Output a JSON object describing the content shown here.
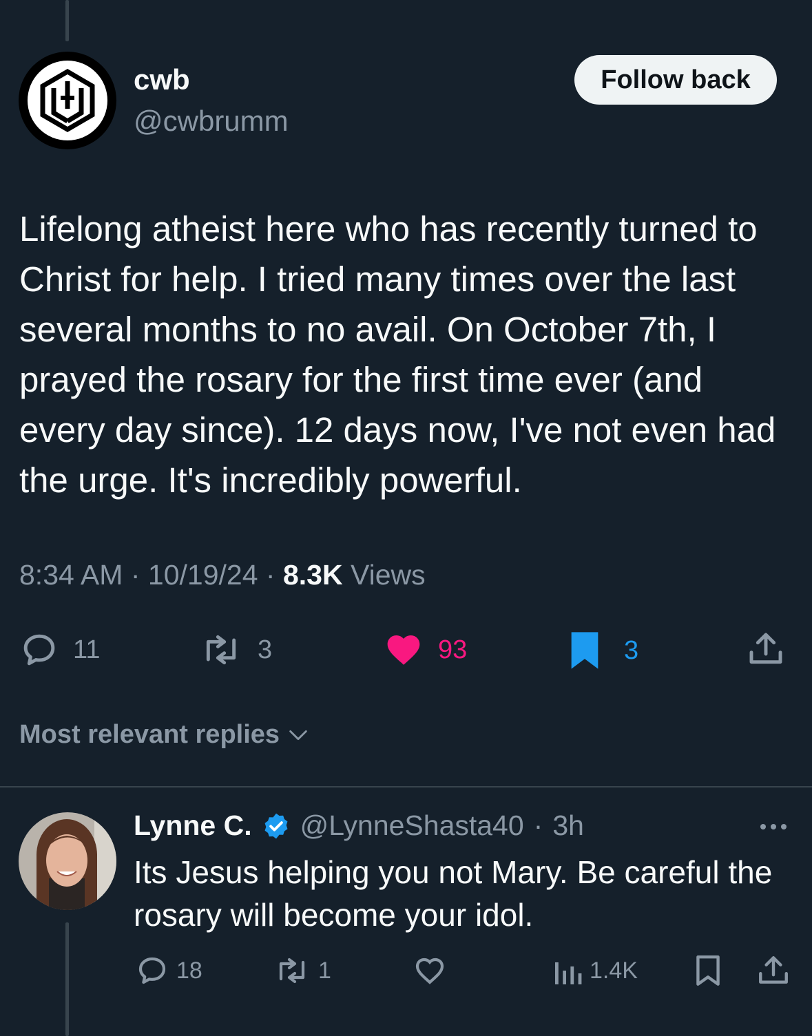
{
  "tweet": {
    "author_name": "cwb",
    "author_handle": "@cwbrumm",
    "follow_label": "Follow back",
    "text": "Lifelong atheist here who has recently turned to Christ for help. I tried many times over the last several months to no avail. On October 7th, I prayed the rosary for the first time ever (and every day since). 12 days now, I've not even had the urge. It's incredibly powerful.",
    "time": "8:34 AM",
    "date": "10/19/24",
    "views_count": "8.3K",
    "views_label": "Views",
    "separator": "·",
    "actions": {
      "replies": "11",
      "reposts": "3",
      "likes": "93",
      "bookmarks": "3"
    },
    "liked": true,
    "bookmarked": true
  },
  "replies_section": {
    "title": "Most relevant replies"
  },
  "reply": {
    "author_name": "Lynne C.",
    "verified": true,
    "author_handle": "@LynneShasta40",
    "separator": "·",
    "time": "3h",
    "text": "Its Jesus helping you not Mary.  Be careful the rosary will become your idol.",
    "actions": {
      "replies": "18",
      "reposts": "1",
      "views": "1.4K"
    }
  },
  "colors": {
    "background": "#15202b",
    "like": "#f91880",
    "bookmark": "#1d9bf0",
    "muted": "#8b98a5",
    "text": "#f7f9f9"
  },
  "icons": [
    "reply-icon",
    "repost-icon",
    "heart-icon",
    "bookmark-icon",
    "share-icon",
    "verified-badge-icon",
    "chevron-down-icon",
    "more-icon",
    "views-icon"
  ]
}
